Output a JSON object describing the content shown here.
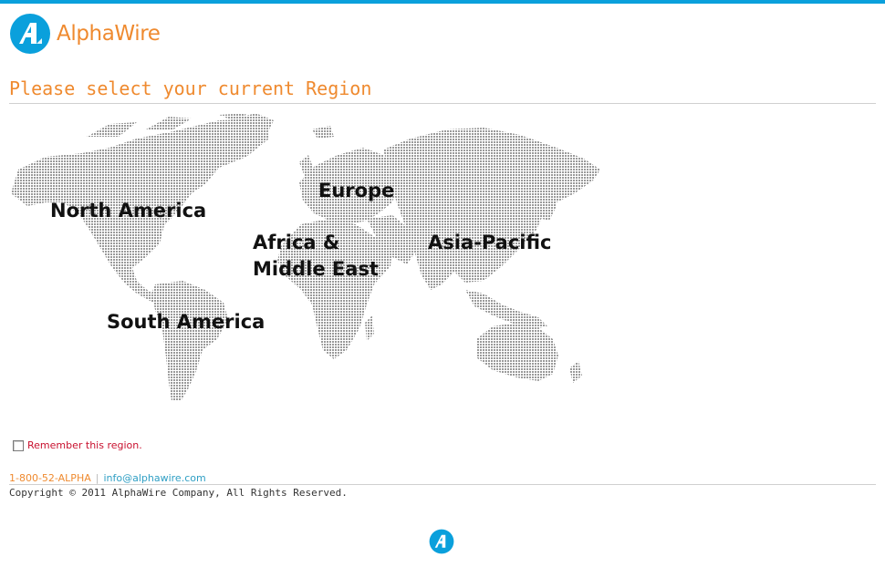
{
  "brand": {
    "name": "AlphaWire",
    "accent_orange": "#ef8a2f",
    "accent_blue": "#0aa0dc"
  },
  "heading": "Please select your current Region",
  "regions": {
    "north_america": "North America",
    "europe": "Europe",
    "africa_line1": "Africa &",
    "africa_line2": "Middle East",
    "asia_pacific": "Asia-Pacific",
    "south_america": "South America"
  },
  "remember": {
    "label": "Remember this region.",
    "checked": false
  },
  "footer": {
    "phone": "1-800-52-ALPHA",
    "separator": "|",
    "email": "info@alphawire.com",
    "copyright": "Copyright © 2011 AlphaWire Company, All Rights Reserved."
  }
}
